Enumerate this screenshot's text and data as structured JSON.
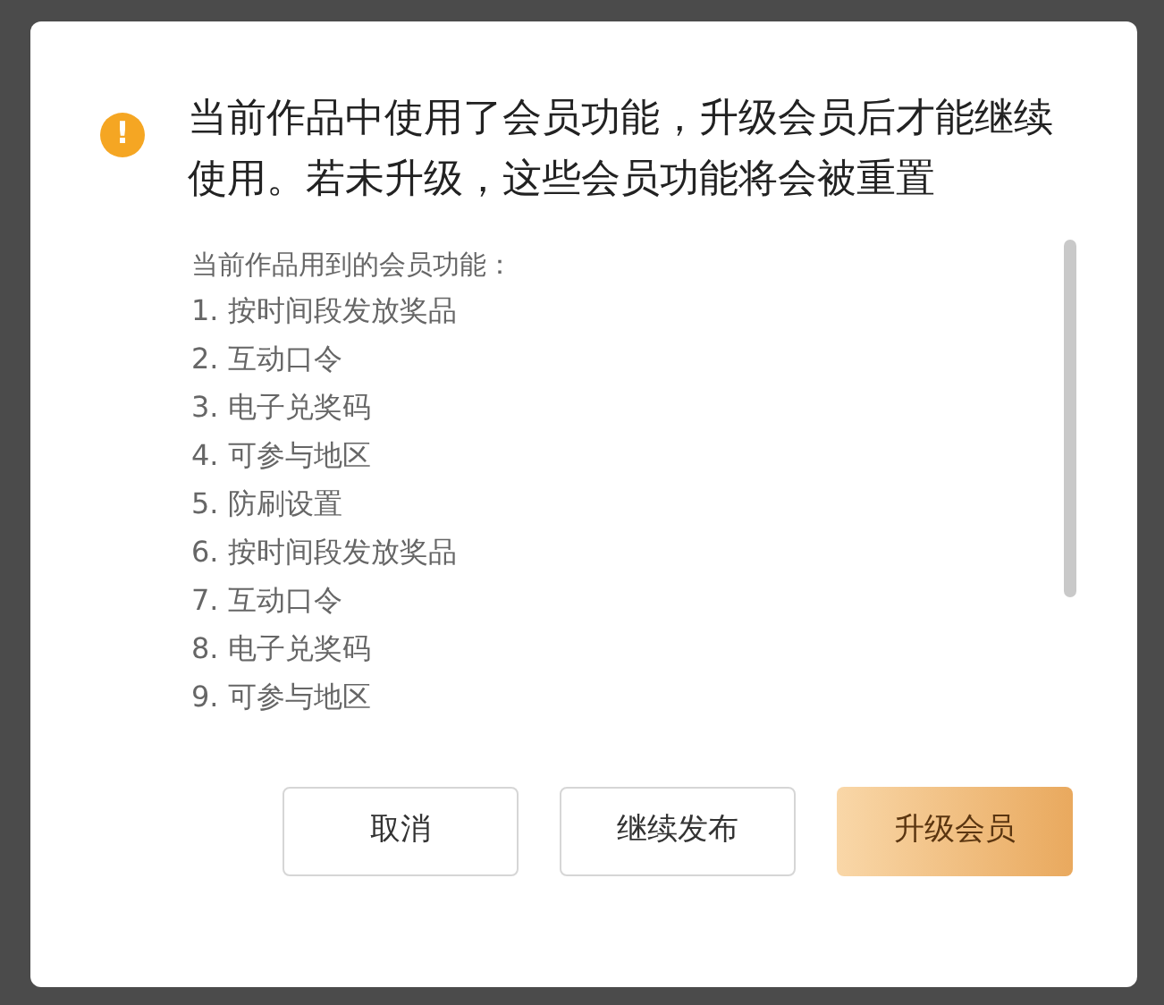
{
  "dialog": {
    "icon": "!",
    "message": "当前作品中使用了会员功能，升级会员后才能继续使用。若未升级，这些会员功能将会被重置",
    "features_heading": "当前作品用到的会员功能：",
    "features": [
      "1. 按时间段发放奖品",
      "2. 互动口令",
      "3. 电子兑奖码",
      "4. 可参与地区",
      "5. 防刷设置",
      "6. 按时间段发放奖品",
      "7. 互动口令",
      "8. 电子兑奖码",
      "9. 可参与地区"
    ],
    "buttons": [
      {
        "label": "取消",
        "kind": "default"
      },
      {
        "label": "继续发布",
        "kind": "default"
      },
      {
        "label": "升级会员",
        "kind": "primary"
      }
    ]
  }
}
